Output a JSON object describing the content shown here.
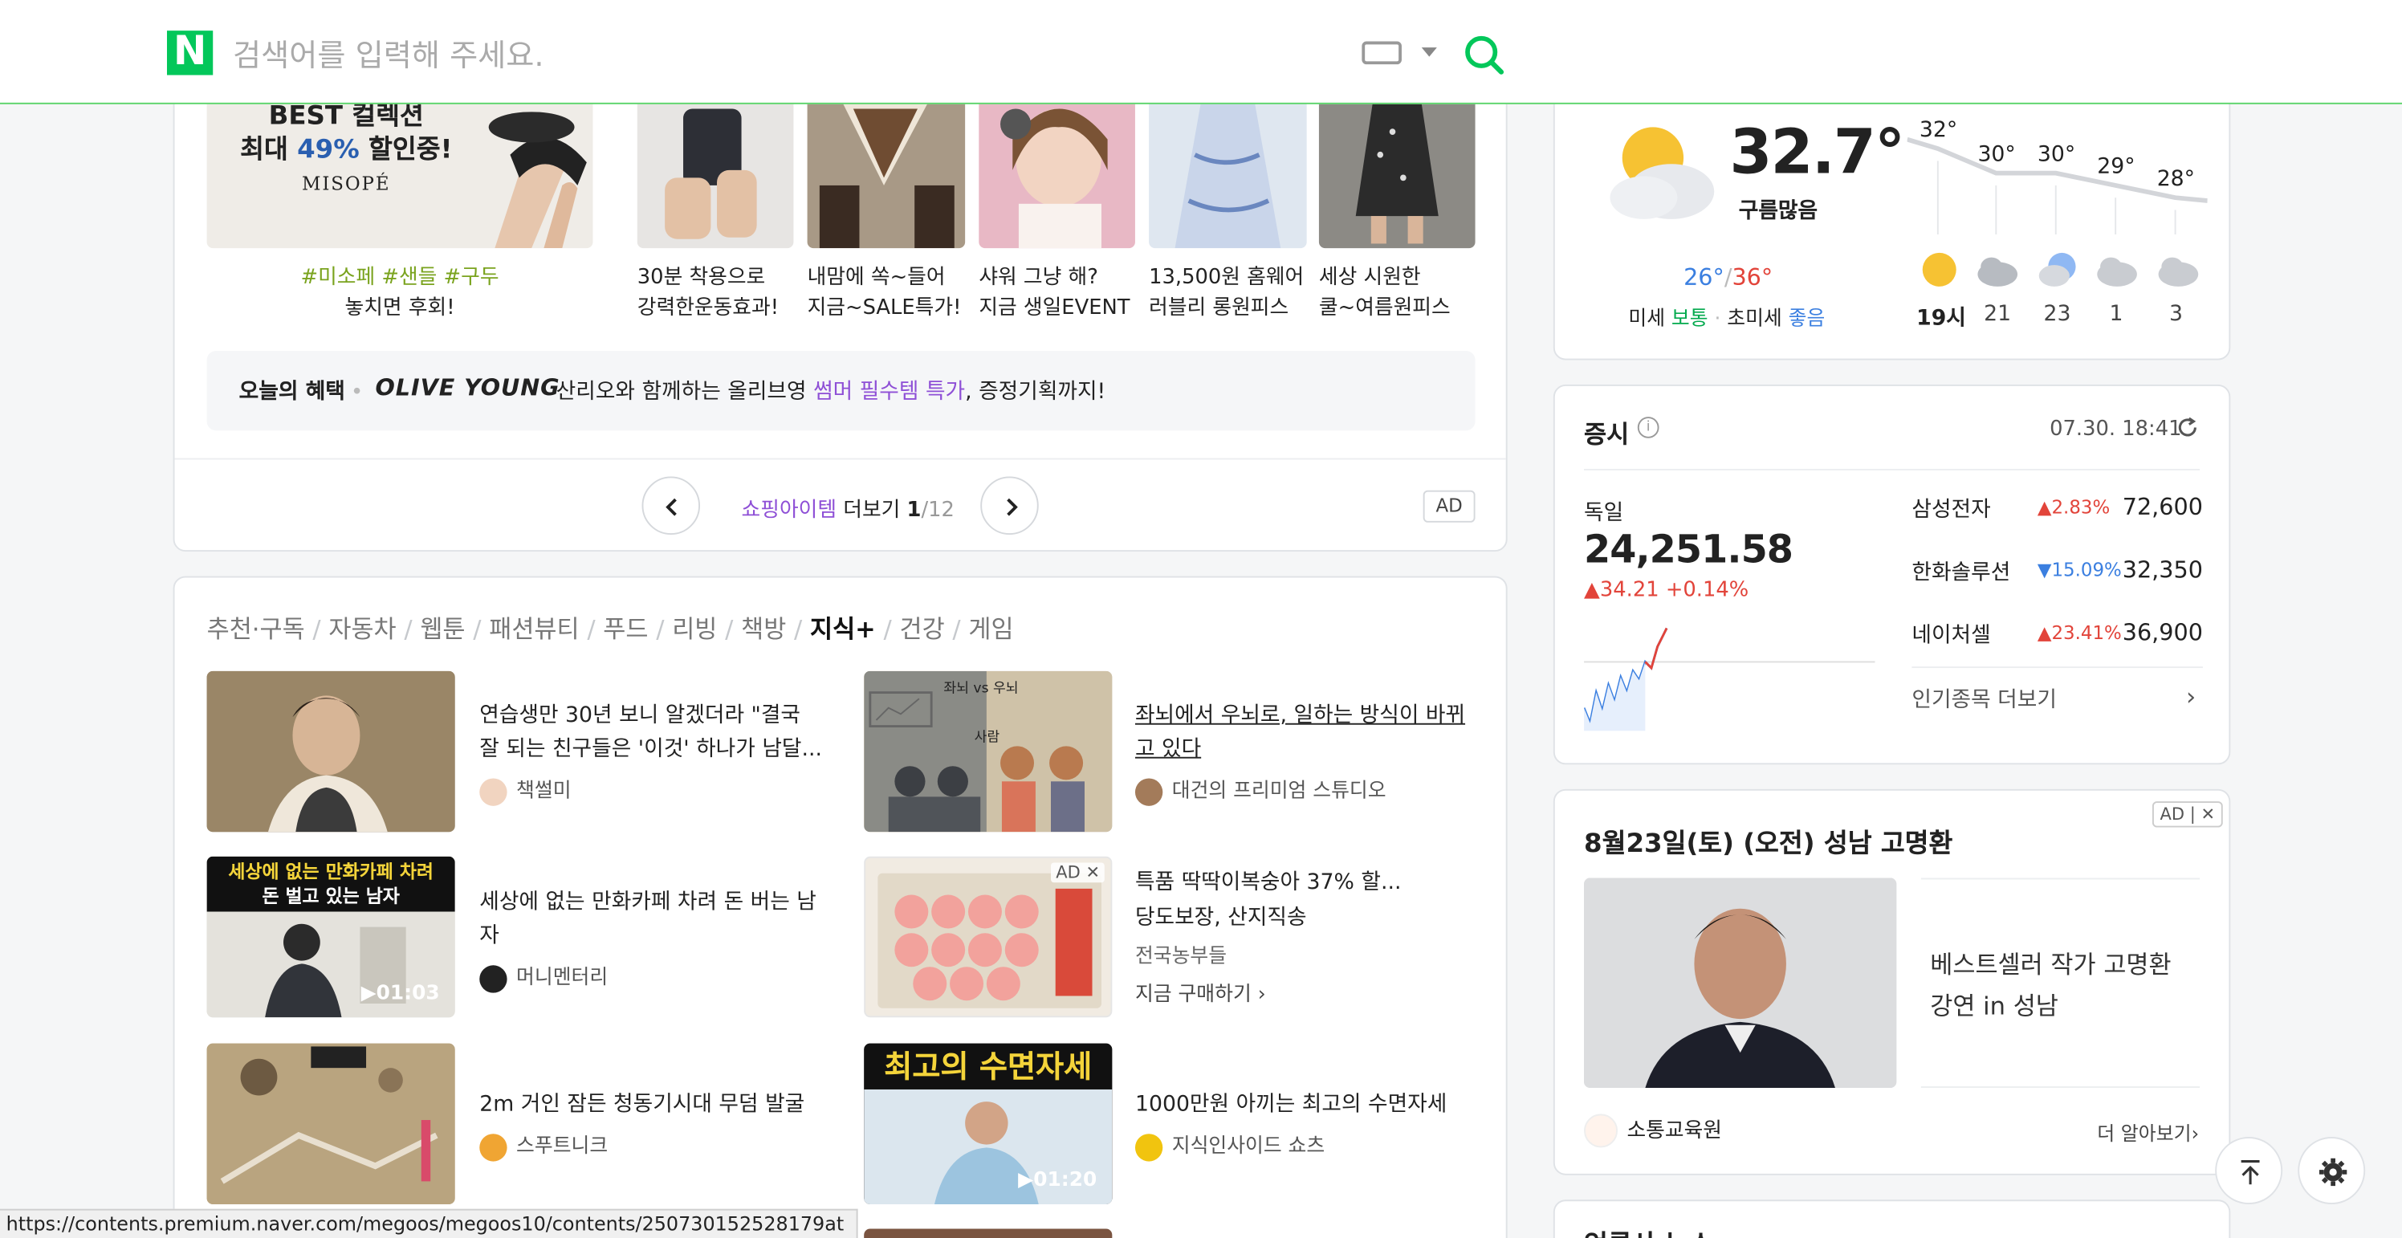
{
  "header": {
    "logo": "N",
    "search_placeholder": "검색어를 입력해 주세요."
  },
  "shopping": {
    "banner_line1": "BEST 컬렉션",
    "banner_line2a": "최대 ",
    "banner_pct": "49%",
    "banner_line2b": " 할인중!",
    "banner_brand": "MISOPÉ",
    "banner_tag": "#미소페 #샌들 #구두",
    "banner_sub": "놓치면 후회!",
    "products": [
      {
        "line1": "30분 착용으로",
        "line2": "강력한운동효과!"
      },
      {
        "line1": "내맘에 쏙~들어",
        "line2": "지금~SALE특가!"
      },
      {
        "line1": "샤워 그냥 해?",
        "line2": "지금 생일EVENT"
      },
      {
        "line1": "13,500원 홈웨어",
        "line2": "러블리 롱원피스"
      },
      {
        "line1": "세상 시원한",
        "line2": "쿨~여름원피스"
      }
    ],
    "benefit_label": "오늘의 혜택",
    "benefit_brand": "OLIVE YOUNG",
    "benefit_pre": "산리오와 함께하는 올리브영 ",
    "benefit_hl": "썸머 필수템 특가",
    "benefit_post": ", 증정기획까지!",
    "pager_cat": "쇼핑아이템",
    "pager_more": " 더보기 ",
    "pager_cur": "1",
    "pager_total": "/12",
    "ad": "AD"
  },
  "feed": {
    "tabs": [
      "추천·구독",
      "자동차",
      "웹툰",
      "패션뷰티",
      "푸드",
      "리빙",
      "책방",
      "지식+",
      "건강",
      "게임"
    ],
    "active_tab": "지식+",
    "items": [
      {
        "title": "연습생만 30년 보니 알겠더라 \"결국 잘 되는 친구들은 '이것' 하나가 남달...",
        "source": "책썰미"
      },
      {
        "title": "좌뇌에서 우뇌로, 일하는 방식이 바뀌고 있다",
        "source": "대건의 프리미엄 스튜디오",
        "thumb_text1": "좌뇌 vs 우뇌",
        "thumb_text2": "사람"
      },
      {
        "title": "세상에 없는 만화카페 차려 돈 버는 남자",
        "source": "머니멘터리",
        "thumb_top": "세상에 없는 만화카페 차려",
        "thumb_top2": "돈 벌고 있는 남자",
        "duration": "01:03"
      },
      {
        "title": "특품 딱딱이복숭아 37% 할...",
        "line2": "당도보장, 산지직송",
        "seller": "전국농부들",
        "cta": "지금 구매하기",
        "ad": "AD"
      },
      {
        "title": "2m 거인 잠든 청동기시대 무덤 발굴",
        "source": "스푸트니크"
      },
      {
        "title": "1000만원 아끼는 최고의 수면자세",
        "source": "지식인사이드 쇼츠",
        "thumb_top": "최고의 수면자세",
        "duration": "01:20"
      }
    ]
  },
  "weather": {
    "temp": "32.7°",
    "cond": "구름많음",
    "low": "26°",
    "high": "36°",
    "slash": "/",
    "dust_label": "미세",
    "dust": "보통",
    "fine_label": "초미세",
    "fine": "좋음",
    "graph_temps": [
      "32°",
      "30°",
      "30°",
      "29°",
      "28°"
    ],
    "hours": [
      "19시",
      "21",
      "23",
      "1",
      "3"
    ],
    "colors": {
      "low": "#3b7fe0",
      "high": "#e2443a",
      "good": "#3b7fe0",
      "normal": "#03a94d"
    }
  },
  "stock": {
    "title": "증시",
    "time": "07.30. 18:41",
    "index_name": "독일",
    "index_value": "24,251.58",
    "index_change": "34.21",
    "index_pct": "+0.14%",
    "rows": [
      {
        "name": "삼성전자",
        "dir": "up",
        "pct": "2.83%",
        "price": "72,600"
      },
      {
        "name": "한화솔루션",
        "dir": "down",
        "pct": "15.09%",
        "price": "32,350"
      },
      {
        "name": "네이처셀",
        "dir": "up",
        "pct": "23.41%",
        "price": "36,900"
      }
    ],
    "more": "인기종목 더보기",
    "colors": {
      "up": "#e2443a",
      "down": "#3b7fe0"
    }
  },
  "event_ad": {
    "ad": "AD",
    "title": "8월23일(토) (오전) 성남 고명환",
    "desc1": "베스트셀러 작가 고명환",
    "desc2": "강연 in 성남",
    "brand": "소통교육원",
    "more": "더 알아보기"
  },
  "news": {
    "title": "언론사 뉴스"
  },
  "status_url": "https://contents.premium.naver.com/megoos/megoos10/contents/250730152528179at"
}
